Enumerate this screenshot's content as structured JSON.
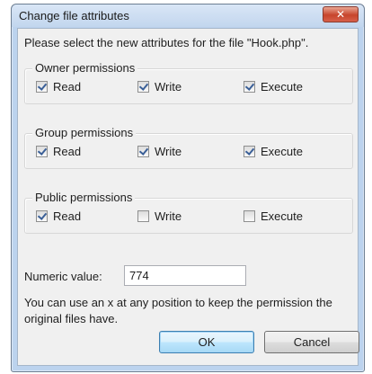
{
  "dialog": {
    "title": "Change file attributes",
    "close_label": "✕",
    "prompt": "Please select the new attributes for the file \"Hook.php\".",
    "groups": [
      {
        "title": "Owner permissions",
        "read": {
          "label": "Read",
          "checked": true
        },
        "write": {
          "label": "Write",
          "checked": true
        },
        "execute": {
          "label": "Execute",
          "checked": true
        }
      },
      {
        "title": "Group permissions",
        "read": {
          "label": "Read",
          "checked": true
        },
        "write": {
          "label": "Write",
          "checked": true
        },
        "execute": {
          "label": "Execute",
          "checked": true
        }
      },
      {
        "title": "Public permissions",
        "read": {
          "label": "Read",
          "checked": true
        },
        "write": {
          "label": "Write",
          "checked": false
        },
        "execute": {
          "label": "Execute",
          "checked": false
        }
      }
    ],
    "numeric_label": "Numeric value:",
    "numeric_value": "774",
    "hint": "You can use an x at any position to keep the permission the original files have.",
    "ok_label": "OK",
    "cancel_label": "Cancel"
  }
}
